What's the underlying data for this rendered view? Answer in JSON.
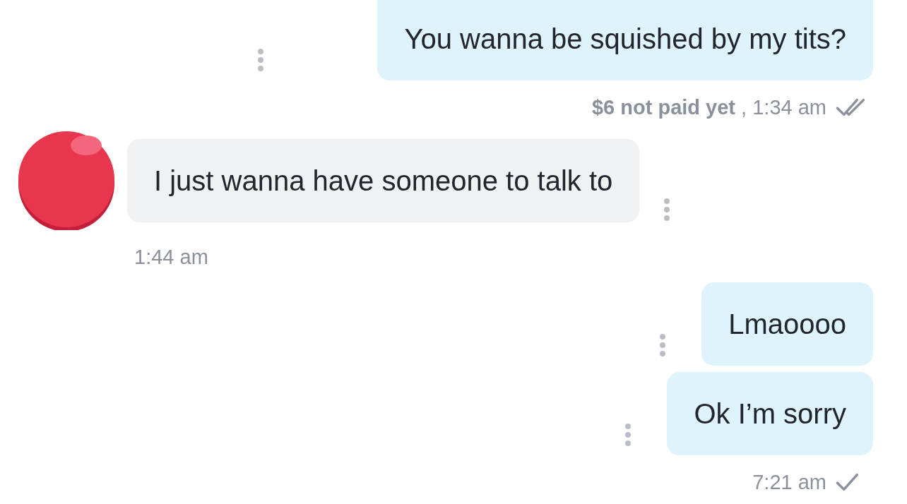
{
  "messages": [
    {
      "kind": "outgoing",
      "text": "You wanna be squished by my tits?",
      "status": "**$6 not paid yet** , 1:34 am",
      "read": true
    },
    {
      "kind": "incoming",
      "text": "I just wanna have someone to talk to",
      "status": "1:44 am"
    },
    {
      "kind": "outgoing",
      "text": "Lmaoooo"
    },
    {
      "kind": "outgoing",
      "text": "Ok I’m sorry",
      "status": "7:21 am",
      "read": false
    }
  ]
}
